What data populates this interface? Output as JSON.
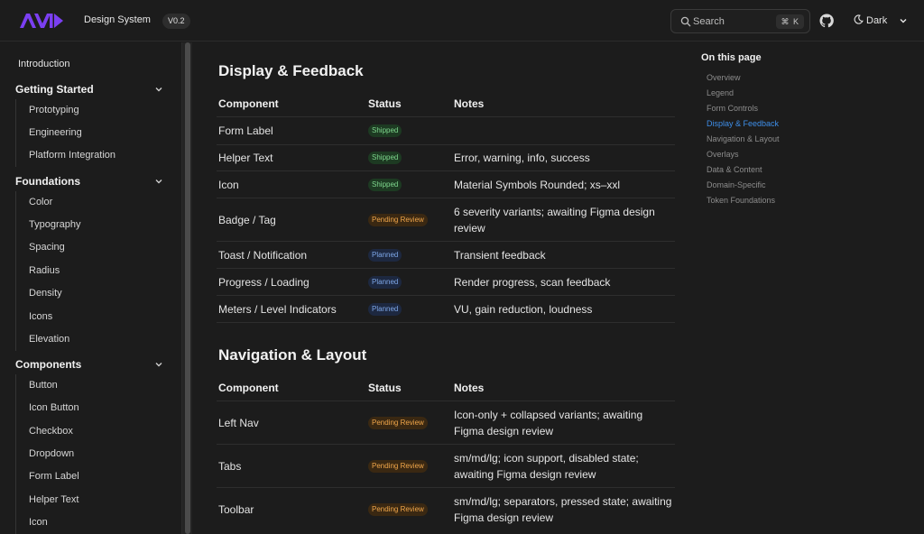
{
  "header": {
    "brand_title": "Design System",
    "version": "V0.2",
    "search": {
      "label": "Search",
      "shortcut": "⌘ K"
    },
    "theme": "Dark",
    "accent_color": "#7b3ff2"
  },
  "sidebar": {
    "intro": "Introduction",
    "sections": [
      {
        "label": "Getting Started",
        "items": [
          "Prototyping",
          "Engineering",
          "Platform Integration"
        ]
      },
      {
        "label": "Foundations",
        "items": [
          "Color",
          "Typography",
          "Spacing",
          "Radius",
          "Density",
          "Icons",
          "Elevation"
        ]
      },
      {
        "label": "Components",
        "items": [
          "Button",
          "Icon Button",
          "Checkbox",
          "Dropdown",
          "Form Label",
          "Helper Text",
          "Icon"
        ]
      }
    ]
  },
  "main": {
    "sections": [
      {
        "title": "Display & Feedback",
        "headers": [
          "Component",
          "Status",
          "Notes"
        ],
        "rows": [
          {
            "component": "Form Label",
            "status": "Shipped",
            "status_kind": "shipped",
            "notes": ""
          },
          {
            "component": "Helper Text",
            "status": "Shipped",
            "status_kind": "shipped",
            "notes": "Error, warning, info, success"
          },
          {
            "component": "Icon",
            "status": "Shipped",
            "status_kind": "shipped",
            "notes": "Material Symbols Rounded; xs–xxl"
          },
          {
            "component": "Badge / Tag",
            "status": "Pending Review",
            "status_kind": "pending",
            "notes": "6 severity variants; awaiting Figma design review"
          },
          {
            "component": "Toast / Notification",
            "status": "Planned",
            "status_kind": "planned",
            "notes": "Transient feedback"
          },
          {
            "component": "Progress / Loading",
            "status": "Planned",
            "status_kind": "planned",
            "notes": "Render progress, scan feedback"
          },
          {
            "component": "Meters / Level Indicators",
            "status": "Planned",
            "status_kind": "planned",
            "notes": "VU, gain reduction, loudness"
          }
        ]
      },
      {
        "title": "Navigation & Layout",
        "headers": [
          "Component",
          "Status",
          "Notes"
        ],
        "rows": [
          {
            "component": "Left Nav",
            "status": "Pending Review",
            "status_kind": "pending",
            "notes": "Icon-only + collapsed variants; awaiting Figma design review"
          },
          {
            "component": "Tabs",
            "status": "Pending Review",
            "status_kind": "pending",
            "notes": "sm/md/lg; icon support, disabled state; awaiting Figma design review"
          },
          {
            "component": "Toolbar",
            "status": "Pending Review",
            "status_kind": "pending",
            "notes": "sm/md/lg; separators, pressed state; awaiting Figma design review"
          }
        ]
      }
    ]
  },
  "toc": {
    "title": "On this page",
    "items": [
      "Overview",
      "Legend",
      "Form Controls",
      "Display & Feedback",
      "Navigation & Layout",
      "Overlays",
      "Data & Content",
      "Domain-Specific",
      "Token Foundations"
    ],
    "active": "Display & Feedback",
    "active_color": "#3e8ee8"
  }
}
